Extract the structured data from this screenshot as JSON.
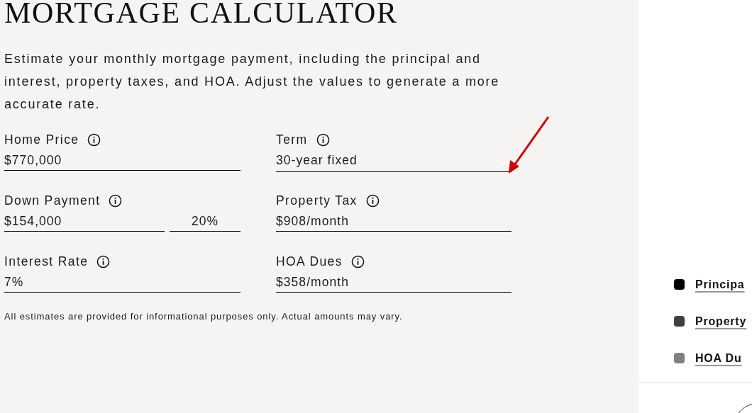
{
  "title": "MORTGAGE CALCULATOR",
  "description": "Estimate your monthly mortgage payment, including the principal and interest, property taxes, and HOA. Adjust the values to generate a more accurate rate.",
  "fields_left": [
    {
      "label": "Home Price",
      "value": "$770,000"
    },
    {
      "label": "Down Payment",
      "value": "$154,000",
      "percent": "20%"
    },
    {
      "label": "Interest Rate",
      "value": "7%"
    }
  ],
  "fields_right": [
    {
      "label": "Term",
      "value": "30-year fixed",
      "kind": "select"
    },
    {
      "label": "Property Tax",
      "value": "$908/month",
      "kind": "input"
    },
    {
      "label": "HOA Dues",
      "value": "$358/month",
      "kind": "input"
    }
  ],
  "disclaimer": "All estimates are provided for informational purposes only. Actual amounts may vary.",
  "legend": [
    {
      "label": "Principa",
      "color": "#000000"
    },
    {
      "label": "Property",
      "color": "#404040"
    },
    {
      "label": "HOA Du",
      "color": "#808080"
    }
  ]
}
